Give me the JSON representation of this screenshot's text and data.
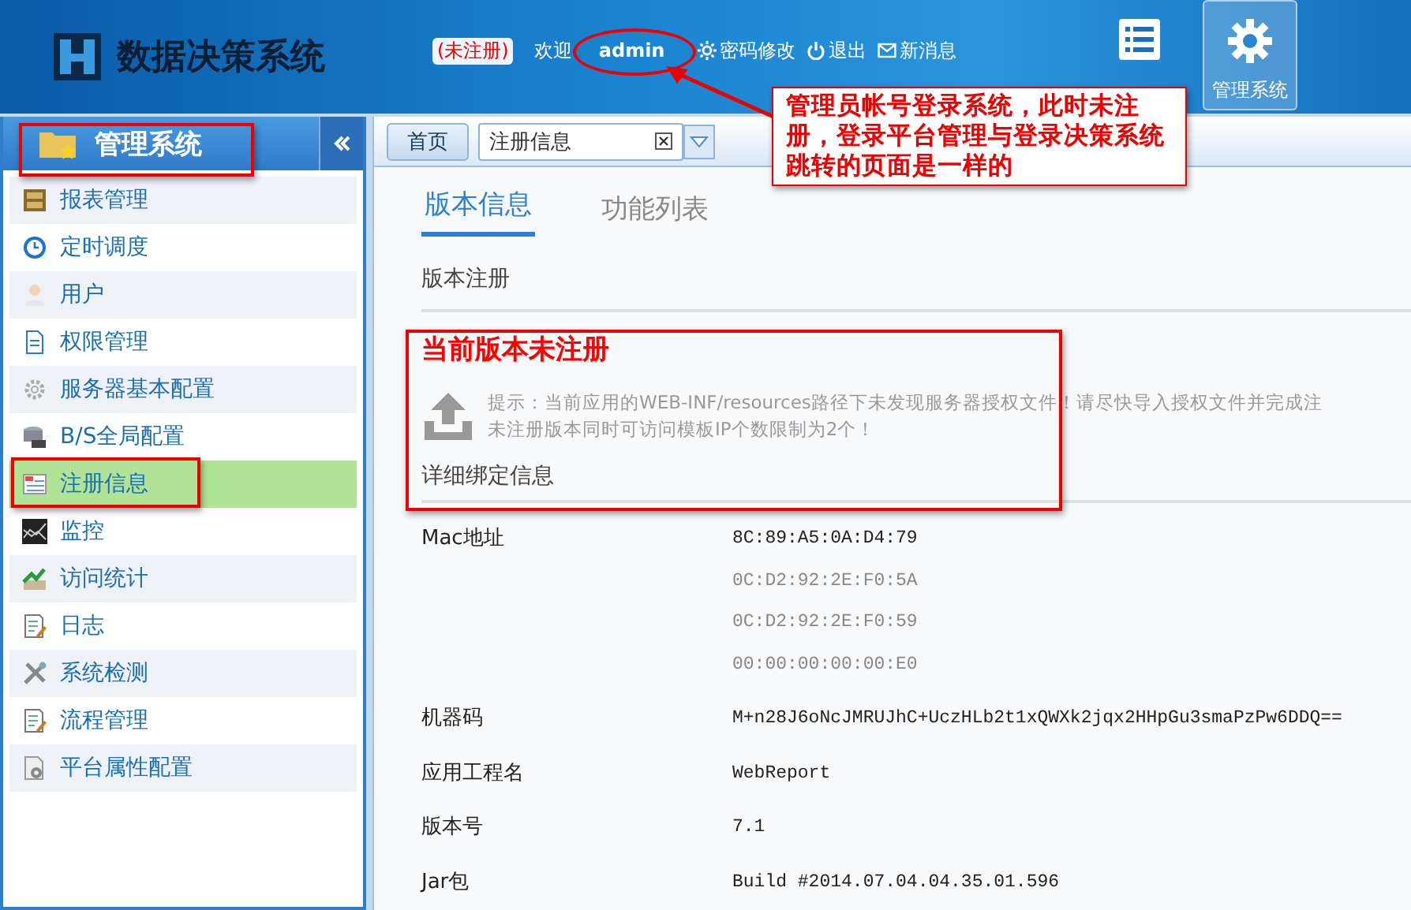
{
  "header": {
    "title": "数据决策系统",
    "unregistered": "(未注册)",
    "welcome": "欢迎",
    "user": "admin",
    "links": [
      {
        "kind": "password",
        "label": "密码修改"
      },
      {
        "kind": "logout",
        "label": "退出"
      },
      {
        "kind": "message",
        "label": "新消息"
      }
    ],
    "top_nav": [
      {
        "kind": "list",
        "selected": false
      },
      {
        "kind": "gear",
        "label": "管理系统",
        "selected": true
      }
    ]
  },
  "sidebar": {
    "title": "管理系统",
    "items": [
      {
        "label": "报表管理",
        "selected": false
      },
      {
        "label": "定时调度",
        "selected": false
      },
      {
        "label": "用户",
        "selected": false
      },
      {
        "label": "权限管理",
        "selected": false
      },
      {
        "label": "服务器基本配置",
        "selected": false
      },
      {
        "label": "B/S全局配置",
        "selected": false
      },
      {
        "label": "注册信息",
        "selected": true
      },
      {
        "label": "监控",
        "selected": false
      },
      {
        "label": "访问统计",
        "selected": false
      },
      {
        "label": "日志",
        "selected": false
      },
      {
        "label": "系统检测",
        "selected": false
      },
      {
        "label": "流程管理",
        "selected": false
      },
      {
        "label": "平台属性配置",
        "selected": false
      }
    ]
  },
  "tabs": [
    {
      "label": "首页",
      "selected": false
    },
    {
      "label": "注册信息",
      "selected": true
    }
  ],
  "subtabs": [
    {
      "label": "版本信息",
      "selected": true
    },
    {
      "label": "功能列表",
      "selected": false
    }
  ],
  "section_title": "版本注册",
  "status": "当前版本未注册",
  "hint": [
    "提示：当前应用的WEB-INF/resources路径下未发现服务器授权文件！请尽快导入授权文件并完成注",
    "未注册版本同时可访问模板IP个数限制为2个！"
  ],
  "details_title": "详细绑定信息",
  "details": [
    {
      "label": "Mac地址",
      "values": [
        {
          "text": "8C:89:A5:0A:D4:79",
          "muted": false
        },
        {
          "text": "0C:D2:92:2E:F0:5A",
          "muted": true
        },
        {
          "text": "0C:D2:92:2E:F0:59",
          "muted": true
        },
        {
          "text": "00:00:00:00:00:E0",
          "muted": true
        }
      ]
    },
    {
      "label": "机器码",
      "values": [
        {
          "text": "M+n28J6oNcJMRUJhC+UczHLb2t1xQWXk2jqx2HHpGu3smaPzPw6DDQ==",
          "muted": false
        }
      ]
    },
    {
      "label": "应用工程名",
      "values": [
        {
          "text": "WebReport",
          "muted": false
        }
      ]
    },
    {
      "label": "版本号",
      "values": [
        {
          "text": "7.1",
          "muted": false
        }
      ]
    },
    {
      "label": "Jar包",
      "values": [
        {
          "text": "Build #2014.07.04.04.35.01.596",
          "muted": false
        }
      ]
    }
  ],
  "callout": "管理员帐号登录系统，此时未注册，登录平台管理与登录决策系统跳转的页面是一样的"
}
